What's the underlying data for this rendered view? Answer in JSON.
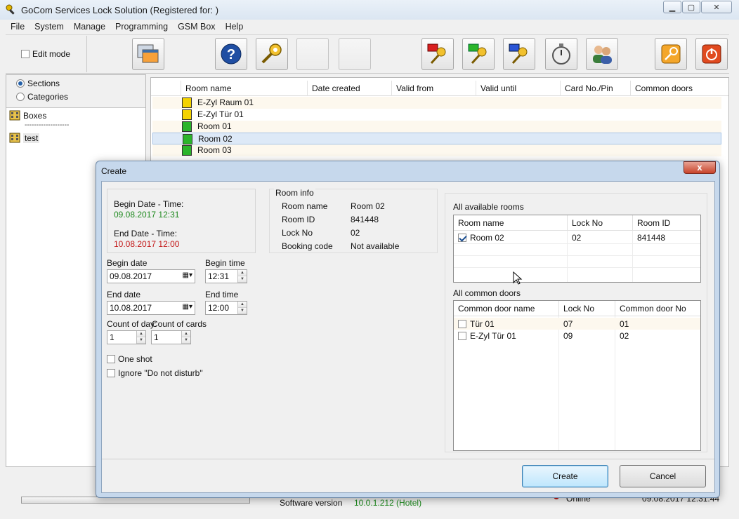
{
  "window": {
    "title": "GoCom Services Lock Solution (Registered for: )"
  },
  "menu": [
    "File",
    "System",
    "Manage",
    "Programming",
    "GSM Box",
    "Help"
  ],
  "toolbar": {
    "edit_mode_label": "Edit mode",
    "edit_mode_checked": false
  },
  "left_panel": {
    "radios": [
      {
        "label": "Sections",
        "selected": true
      },
      {
        "label": "Categories",
        "selected": false
      }
    ],
    "tree": [
      {
        "label": "Boxes"
      },
      {
        "label": "test"
      }
    ],
    "separator": "-------------------"
  },
  "room_list": {
    "columns": [
      "Room name",
      "Date created",
      "Valid from",
      "Valid until",
      "Card No./Pin",
      "Common doors"
    ],
    "rows": [
      {
        "name": "E-Zyl Raum 01",
        "icon_color": "#f4d300"
      },
      {
        "name": "E-Zyl Tür 01",
        "icon_color": "#f4d300"
      },
      {
        "name": "Room 01",
        "icon_color": "#2bb52b"
      },
      {
        "name": "Room 02",
        "icon_color": "#2bb52b",
        "selected": true
      },
      {
        "name": "Room 03",
        "icon_color": "#2bb52b"
      }
    ]
  },
  "statusbar": {
    "software_version_label": "Software version",
    "software_version_value": "10.0.1.212 (Hotel)",
    "connection_status": "Online",
    "datetime": "09.08.2017 12:31:44"
  },
  "dialog": {
    "title": "Create",
    "close_label": "x",
    "schedule": {
      "begin_label": "Begin Date - Time:",
      "begin_value": "09.08.2017 12:31",
      "end_label": "End Date - Time:",
      "end_value": "10.08.2017 12:00"
    },
    "form": {
      "begin_date_label": "Begin date",
      "begin_date_value": "09.08.2017",
      "begin_time_label": "Begin time",
      "begin_time_value": "12:31",
      "end_date_label": "End date",
      "end_date_value": "10.08.2017",
      "end_time_label": "End time",
      "end_time_value": "12:00",
      "count_days_label": "Count of day:",
      "count_days_value": "1",
      "count_cards_label": "Count of cards",
      "count_cards_value": "1",
      "one_shot_label": "One shot",
      "one_shot_checked": false,
      "ignore_dnd_label": "Ignore \"Do not disturb\"",
      "ignore_dnd_checked": false
    },
    "room_info": {
      "title": "Room info",
      "fields": [
        {
          "label": "Room name",
          "value": "Room 02"
        },
        {
          "label": "Room ID",
          "value": "841448"
        },
        {
          "label": "Lock No",
          "value": "02"
        },
        {
          "label": "Booking code",
          "value": "Not available"
        }
      ]
    },
    "available_rooms": {
      "title": "All available rooms",
      "columns": [
        "Room name",
        "Lock No",
        "Room ID"
      ],
      "rows": [
        {
          "checked": true,
          "name": "Room 02",
          "lock_no": "02",
          "room_id": "841448"
        }
      ]
    },
    "common_doors": {
      "title": "All common doors",
      "columns": [
        "Common door name",
        "Lock No",
        "Common door No"
      ],
      "rows": [
        {
          "checked": false,
          "name": "Tür 01",
          "lock_no": "07",
          "door_no": "01"
        },
        {
          "checked": false,
          "name": "E-Zyl Tür 01",
          "lock_no": "09",
          "door_no": "02"
        }
      ]
    },
    "buttons": {
      "create": "Create",
      "cancel": "Cancel"
    }
  }
}
